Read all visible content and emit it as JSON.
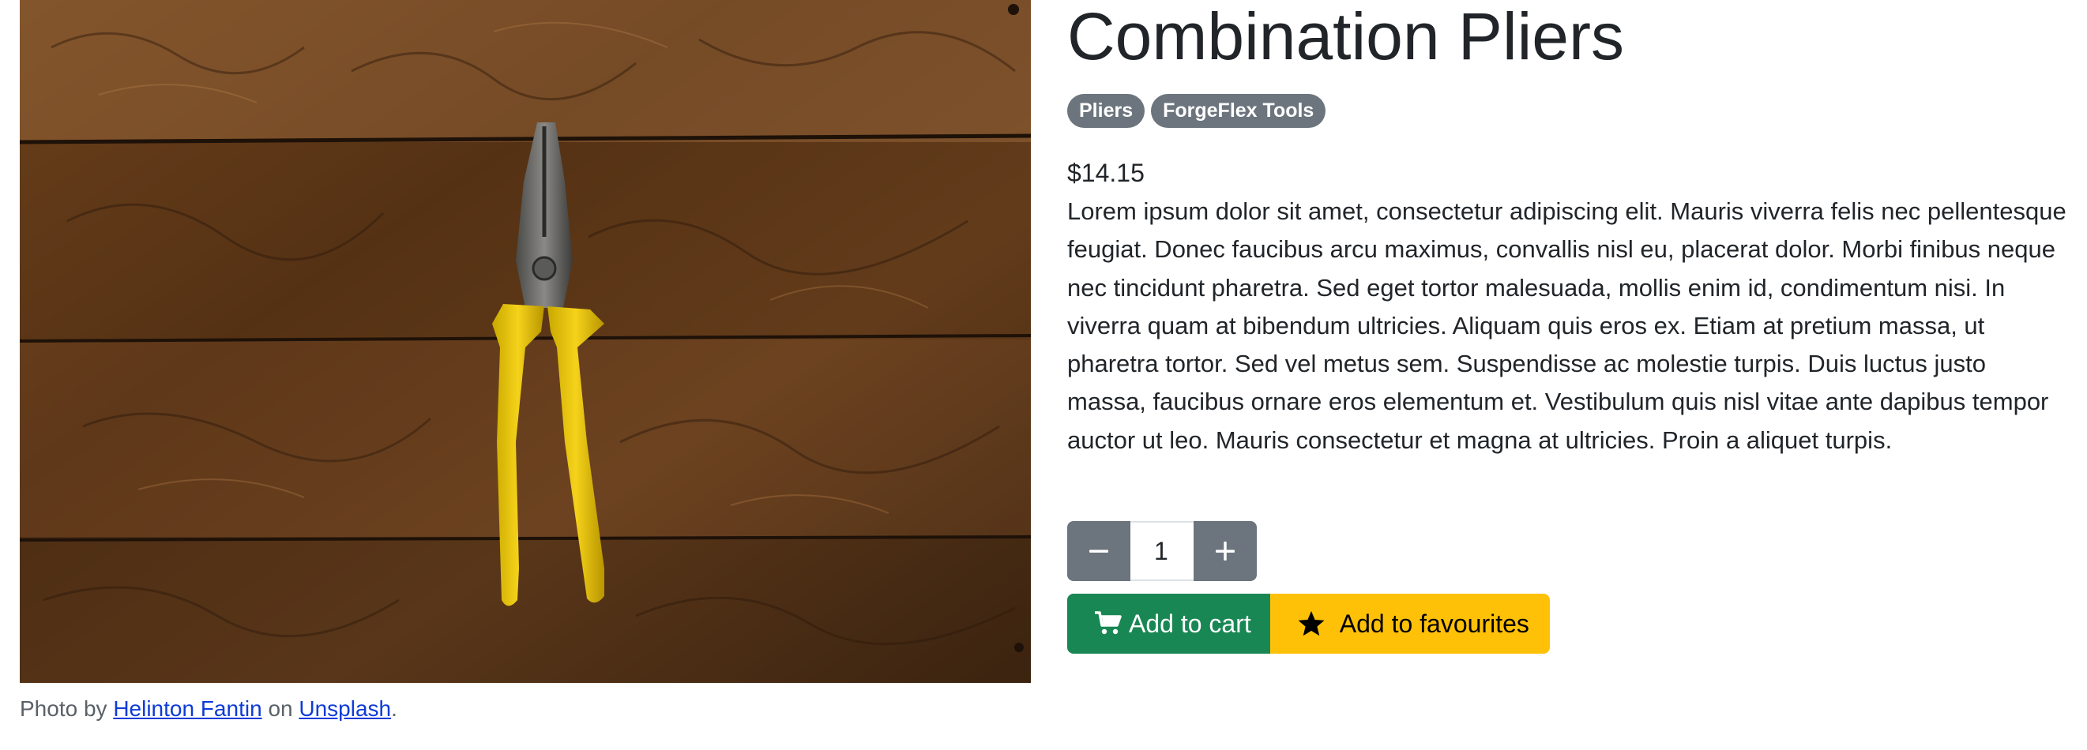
{
  "product": {
    "title": "Combination Pliers",
    "badges": [
      "Pliers",
      "ForgeFlex Tools"
    ],
    "price": "$14.15",
    "description": "Lorem ipsum dolor sit amet, consectetur adipiscing elit. Mauris viverra felis nec pellentesque feugiat. Donec faucibus arcu maximus, convallis nisl eu, placerat dolor. Morbi finibus neque nec tincidunt pharetra. Sed eget tortor malesuada, mollis enim id, condimentum nisi. In viverra quam at bibendum ultricies. Aliquam quis eros ex. Etiam at pretium massa, ut pharetra tortor. Sed vel metus sem. Suspendisse ac molestie turpis. Duis luctus justo massa, faucibus ornare eros elementum et. Vestibulum quis nisl vitae ante dapibus tempor auctor ut leo. Mauris consectetur et magna at ultricies. Proin a aliquet turpis."
  },
  "caption": {
    "prefix": "Photo by",
    "author": "Helinton Fantin",
    "middle": "on",
    "source": "Unsplash",
    "suffix": "."
  },
  "quantity": {
    "value": "1",
    "decrease_icon": "minus-icon",
    "increase_icon": "plus-icon"
  },
  "actions": {
    "add_to_cart": "Add to cart",
    "add_to_favourites": "Add to favourites",
    "cart_icon": "shopping-cart-icon",
    "favourite_icon": "star-icon"
  },
  "colors": {
    "badge": "#6c757d",
    "qty_button": "#6c757d",
    "cart_button": "#198754",
    "favourites_button": "#ffc107",
    "link": "#0d3bd8"
  }
}
